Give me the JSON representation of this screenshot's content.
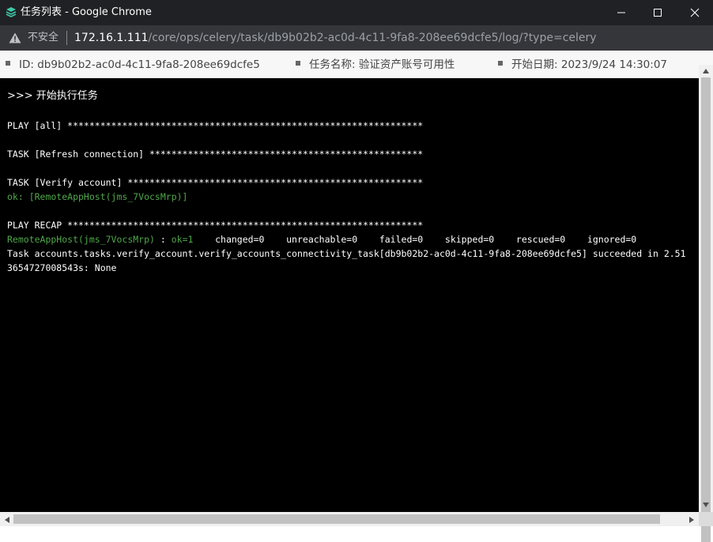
{
  "window": {
    "title": "任务列表 - Google Chrome",
    "icon": "app-logo-icon",
    "controls": [
      "minimize-icon",
      "maximize-icon",
      "close-icon"
    ]
  },
  "address_bar": {
    "security_label": "不安全",
    "security_icon": "warning-triangle-icon",
    "url_host": "172.16.1.111",
    "url_path": "/core/ops/celery/task/db9b02b2-ac0d-4c11-9fa8-208ee69dcfe5/log/?type=celery"
  },
  "info": {
    "id_label": "ID:",
    "id_value": "db9b02b2-ac0d-4c11-9fa8-208ee69dcfe5",
    "name_label": "任务名称:",
    "name_value": "验证资产账号可用性",
    "date_label": "开始日期:",
    "date_value": "2023/9/24 14:30:07"
  },
  "terminal": {
    "start_line": ">>> 开始执行任务",
    "play_all": "PLAY [all] *****************************************************************",
    "task_refresh": "TASK [Refresh connection] **************************************************",
    "task_verify": "TASK [Verify account] ******************************************************",
    "ok_host": "ok: [RemoteAppHost(jms_7VocsMrp)]",
    "play_recap": "PLAY RECAP *****************************************************************",
    "recap_host": "RemoteAppHost(jms_7VocsMrp)",
    "recap_sep": " : ",
    "recap_ok": "ok=1",
    "recap_rest": "    changed=0    unreachable=0    failed=0    skipped=0    rescued=0    ignored=0",
    "task_result_1": "Task accounts.tasks.verify_account.verify_accounts_connectivity_task[db9b02b2-ac0d-4c11-9fa8-208ee69dcfe5] succeeded in 2.51",
    "task_result_2": "3654727008543s: None"
  },
  "colors": {
    "titlebar": "#202124",
    "addressbar": "#35363a",
    "terminal_bg": "#000000",
    "terminal_text": "#ffffff",
    "terminal_ok": "#4fa84b"
  }
}
